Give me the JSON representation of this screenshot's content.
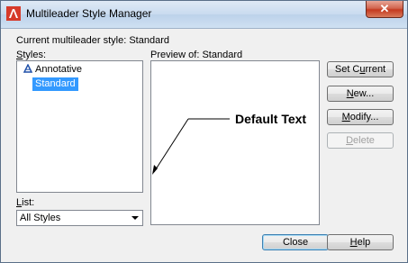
{
  "window": {
    "title": "Multileader Style Manager",
    "close_glyph": "✕"
  },
  "current_style": {
    "label": "Current multileader style: Standard"
  },
  "styles": {
    "label_prefix": "",
    "label_ul": "S",
    "label_rest": "tyles:",
    "items": [
      {
        "label": "Annotative",
        "icon": "annotative-icon",
        "selected": false
      },
      {
        "label": "Standard",
        "selected": true
      }
    ]
  },
  "list": {
    "label_ul": "L",
    "label_rest": "ist:",
    "selected": "All Styles"
  },
  "preview": {
    "label": "Preview of: Standard",
    "leader_text": "Default Text"
  },
  "buttons": {
    "set_current": {
      "pre": "Set C",
      "ul": "u",
      "post": "rrent"
    },
    "new": {
      "pre": "",
      "ul": "N",
      "post": "ew..."
    },
    "modify": {
      "pre": "",
      "ul": "M",
      "post": "odify..."
    },
    "delete": {
      "pre": "",
      "ul": "D",
      "post": "elete"
    },
    "close": {
      "label": "Close"
    },
    "help": {
      "pre": "",
      "ul": "H",
      "post": "elp"
    }
  },
  "colors": {
    "accent": "#3399ff",
    "annotative_icon": "#1f4fa8"
  }
}
